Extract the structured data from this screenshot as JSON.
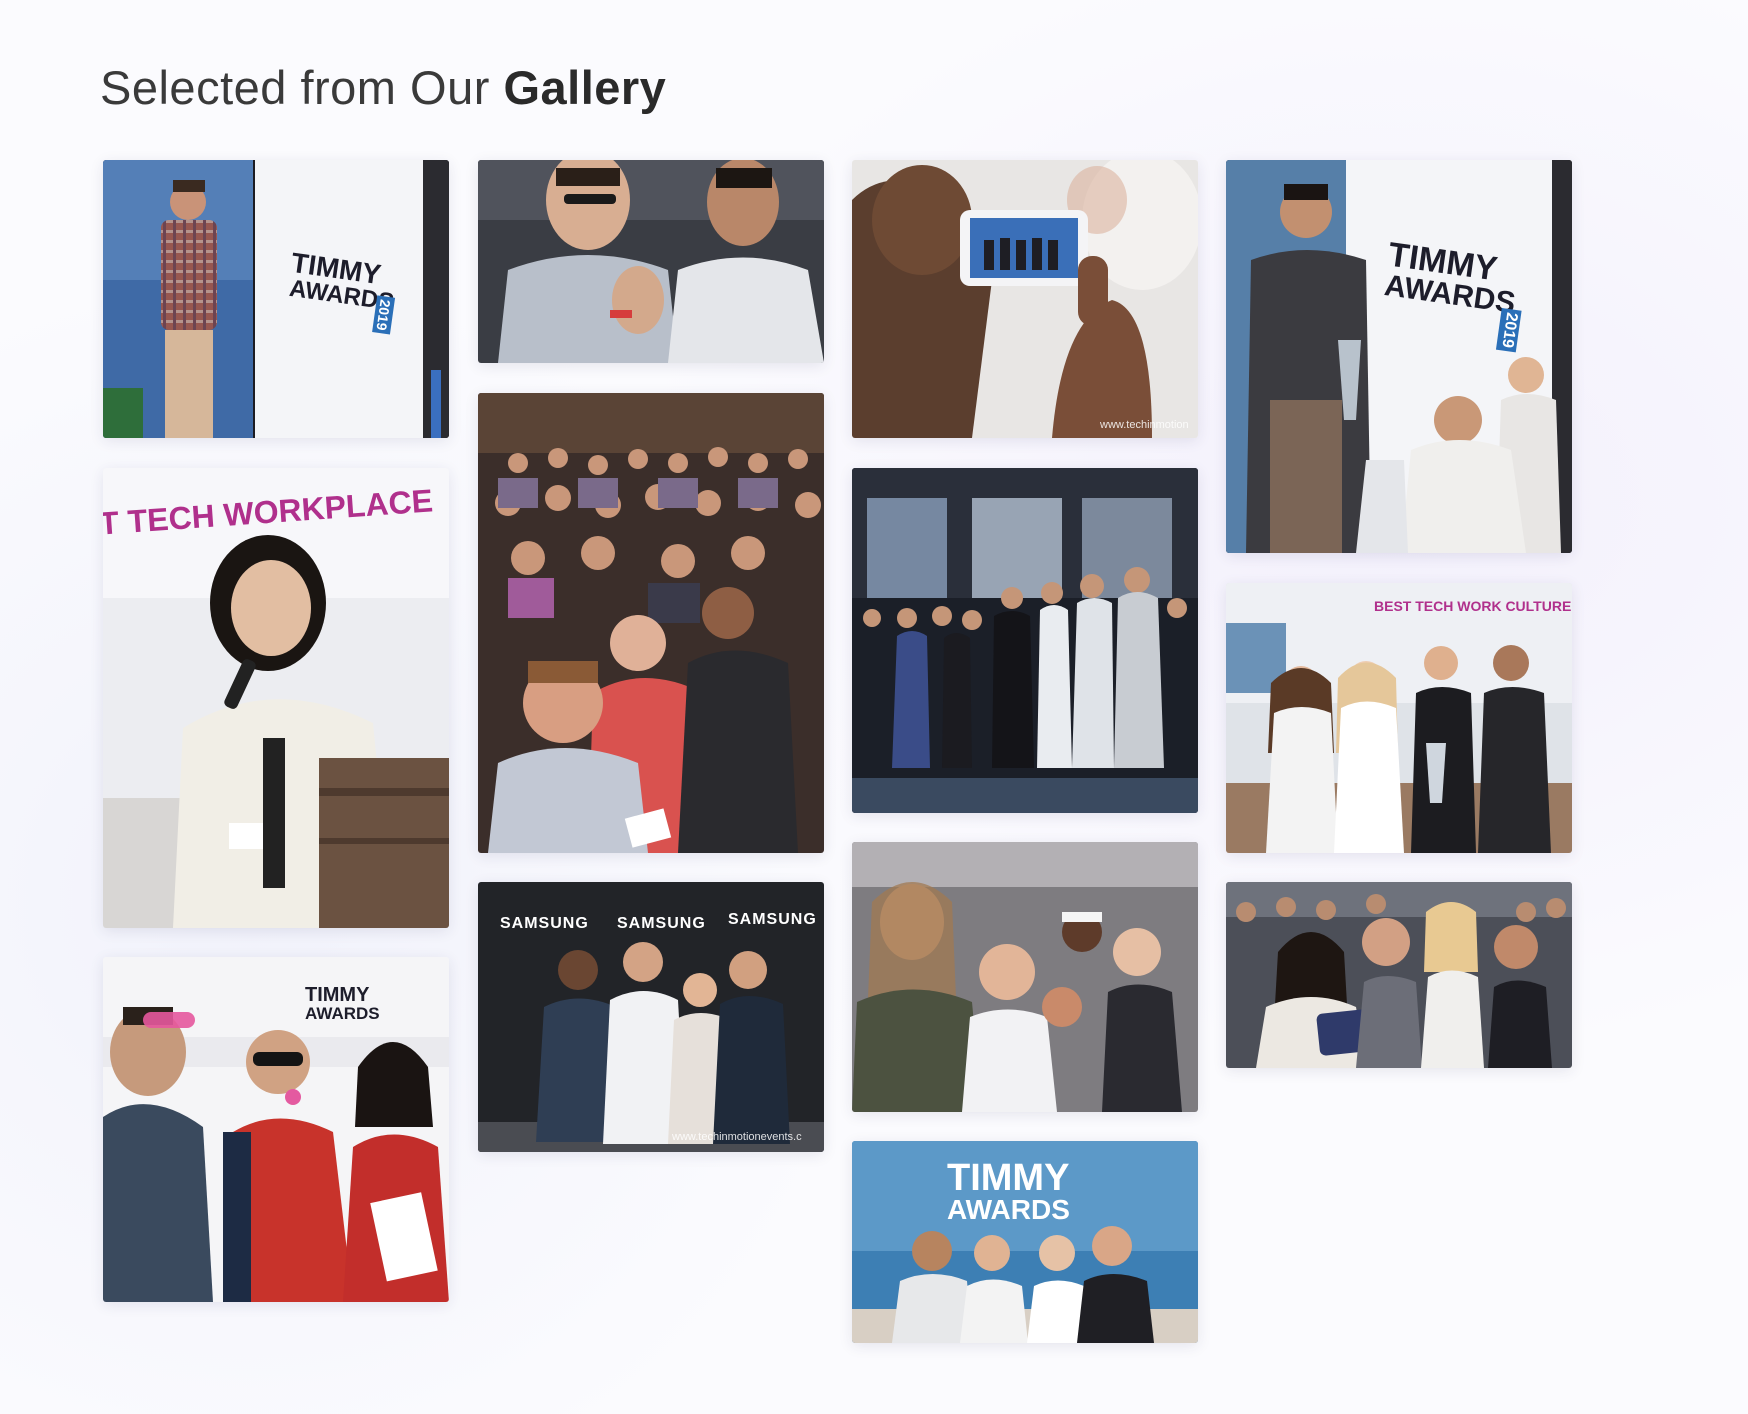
{
  "page": {
    "title_light": "Selected from Our ",
    "title_bold": "Gallery"
  },
  "gallery": {
    "photos": [
      {
        "id": "speaker-timmy-2019",
        "banner": [
          "TIMMY",
          "AWARDS",
          "2019"
        ]
      },
      {
        "id": "audience-clapping"
      },
      {
        "id": "phone-photo",
        "watermark": "www.techinmotion"
      },
      {
        "id": "winner-trophy",
        "banner": [
          "TIMMY",
          "AWARDS",
          "2019"
        ]
      },
      {
        "id": "tech-workplace-speaker",
        "banner": [
          "T TECH WORKPLACE"
        ]
      },
      {
        "id": "seated-crowd"
      },
      {
        "id": "standing-crowd"
      },
      {
        "id": "best-tech-work-culture",
        "banner": [
          "BEST TECH WORK CULTURE"
        ]
      },
      {
        "id": "photo-booth-props",
        "banner": [
          "TIMMY",
          "AWARDS"
        ]
      },
      {
        "id": "samsung-backdrop",
        "banner": [
          "SAMSUNG",
          "SAMSUNG",
          "SAMSUNG"
        ],
        "watermark": "www.techinmotionevents.c"
      },
      {
        "id": "crowd-excited"
      },
      {
        "id": "group-selfie"
      },
      {
        "id": "timmy-awards-group",
        "banner": [
          "TIMMY",
          "AWARDS"
        ]
      }
    ]
  }
}
